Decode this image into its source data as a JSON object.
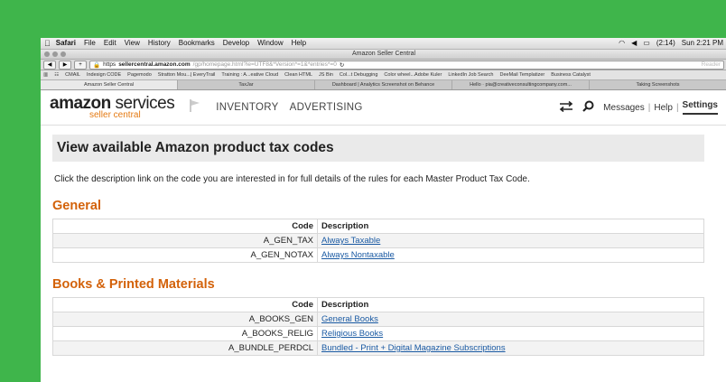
{
  "menubar": {
    "app": "Safari",
    "items": [
      "File",
      "Edit",
      "View",
      "History",
      "Bookmarks",
      "Develop",
      "Window",
      "Help"
    ],
    "battery": "(2:14)",
    "clock": "Sun 2:21 PM"
  },
  "window": {
    "title": "Amazon Seller Central"
  },
  "toolbar": {
    "back": "◀",
    "forward": "▶",
    "add": "+",
    "https": "https",
    "url_host": "sellercentral.amazon.com",
    "url_path": "/gp/homepage.html?ie=UTF8&*Version*=1&*entries*=0",
    "reader": "Reader"
  },
  "bookmarks": [
    "CMAIL",
    "Indesign CODE",
    "Pagemodo",
    "Stratton Mou...| EveryTrail",
    "Training : A...eative Cloud",
    "Clean HTML",
    "JS Bin",
    "Col...t Debugging",
    "Color wheel...Adobe Kuler",
    "LinkedIn Job Search",
    "DeeMail Templatizer",
    "Business Catalyst"
  ],
  "tabs": [
    "Amazon Seller Central",
    "TaxJar",
    "Dashboard | Analytics Screenshot on Behance",
    "Hello · pia@creativeconsultingcompany.com...",
    "Taking Screenshots"
  ],
  "header": {
    "logo_line1_a": "amazon",
    "logo_line1_b": "services",
    "logo_line2": "seller central",
    "nav": [
      "INVENTORY",
      "ADVERTISING"
    ],
    "messages": "Messages",
    "help": "Help",
    "settings": "Settings"
  },
  "page": {
    "title": "View available Amazon product tax codes",
    "intro": "Click the description link on the code you are interested in for full details of the rules for each Master Product Tax Code.",
    "col_code": "Code",
    "col_desc": "Description",
    "sections": [
      {
        "heading": "General",
        "rows": [
          {
            "code": "A_GEN_TAX",
            "desc": "Always Taxable"
          },
          {
            "code": "A_GEN_NOTAX",
            "desc": "Always Nontaxable"
          }
        ]
      },
      {
        "heading": "Books & Printed Materials",
        "rows": [
          {
            "code": "A_BOOKS_GEN",
            "desc": "General Books"
          },
          {
            "code": "A_BOOKS_RELIG",
            "desc": "Religious Books"
          },
          {
            "code": "A_BUNDLE_PERDCL",
            "desc": "Bundled - Print + Digital Magazine Subscriptions"
          }
        ]
      }
    ]
  },
  "colors": {
    "frame_green": "#3fb54b",
    "section_orange": "#d3620a",
    "link_blue": "#1a5aa3"
  }
}
